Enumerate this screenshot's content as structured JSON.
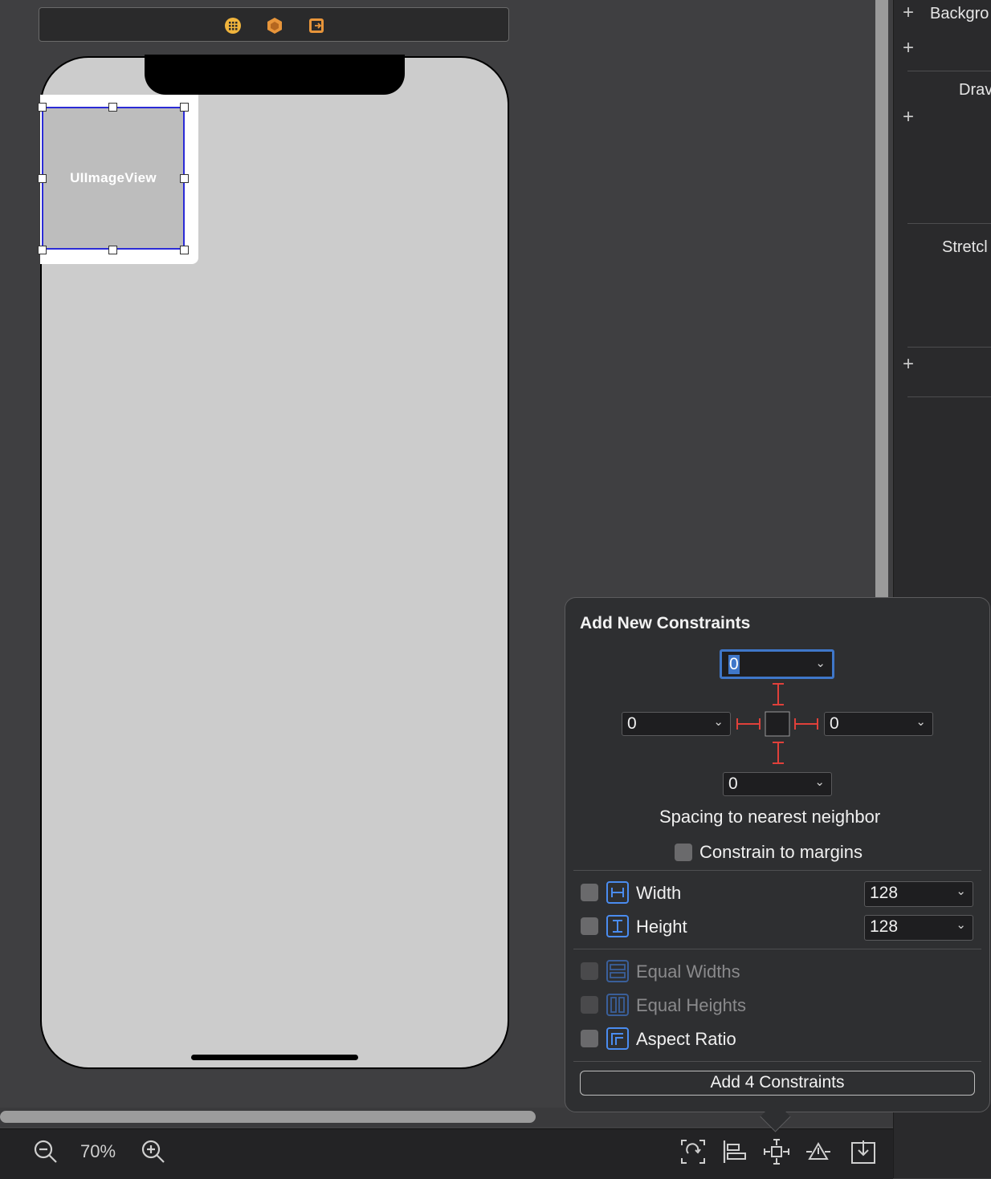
{
  "canvas": {
    "image_view_label": "UIImageView",
    "zoom": "70%"
  },
  "inspector": {
    "items": [
      "Backgro",
      "Drav",
      "Stretcl"
    ]
  },
  "popover": {
    "title": "Add New Constraints",
    "spacing": {
      "top": "0",
      "left": "0",
      "right": "0",
      "bottom": "0"
    },
    "spacing_caption": "Spacing to nearest neighbor",
    "constrain_margins": "Constrain to margins",
    "width_label": "Width",
    "width_value": "128",
    "height_label": "Height",
    "height_value": "128",
    "equal_widths": "Equal Widths",
    "equal_heights": "Equal Heights",
    "aspect_ratio": "Aspect Ratio",
    "add_button": "Add 4 Constraints"
  },
  "colors": {
    "accent": "#3f77c9",
    "constraint_red": "#e0403a",
    "selection": "#2b2bd6"
  }
}
